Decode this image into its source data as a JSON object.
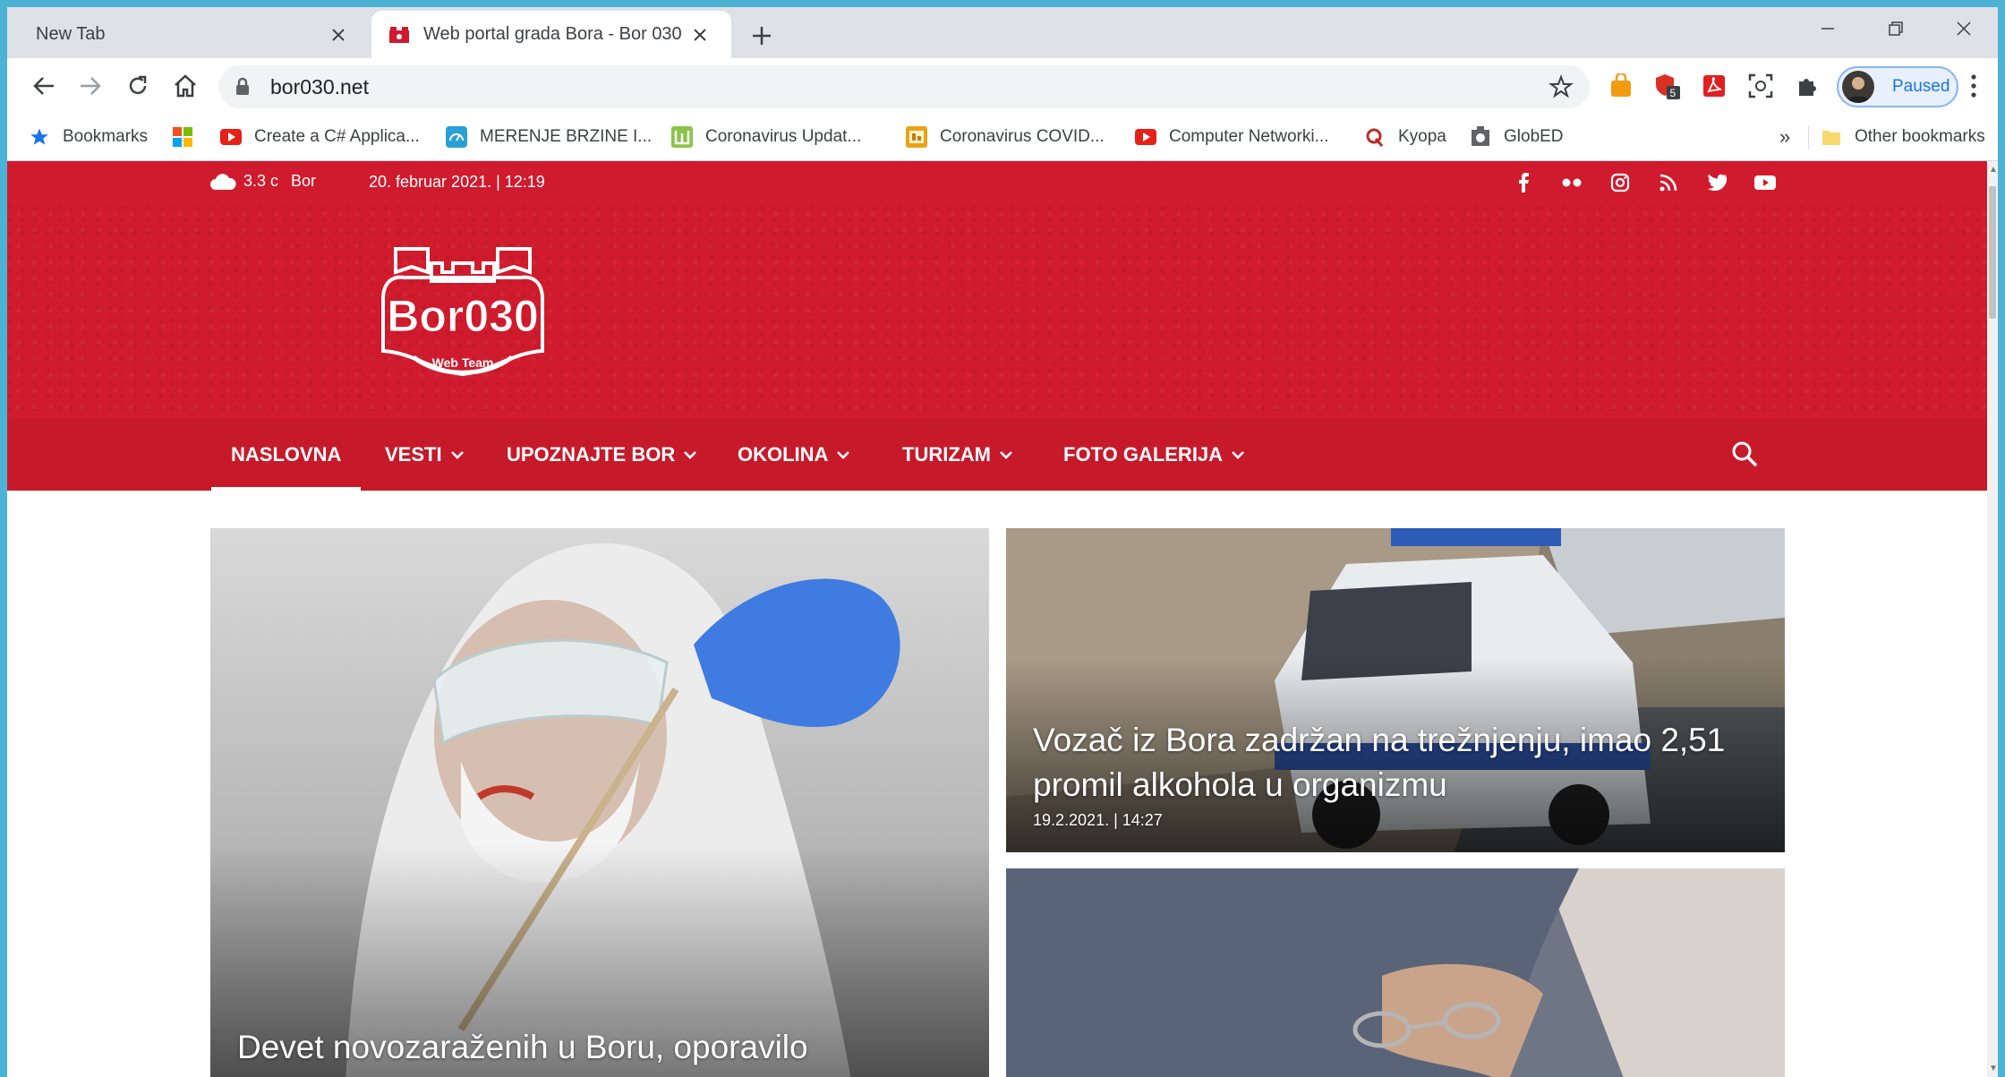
{
  "browser": {
    "tabs": [
      {
        "title": "New Tab",
        "active": false
      },
      {
        "title": "Web portal grada Bora - Bor 030",
        "active": true
      }
    ],
    "url": "bor030.net",
    "profile_label": "Paused",
    "extension_badge": "5",
    "bookmarks": [
      {
        "label": "Bookmarks",
        "icon": "star-icon"
      },
      {
        "label": "",
        "icon": "windows-icon"
      },
      {
        "label": "Create a C# Applica...",
        "icon": "youtube-icon"
      },
      {
        "label": "MERENJE BRZINE I...",
        "icon": "speedtest-icon"
      },
      {
        "label": "Coronavirus Updat...",
        "icon": "worldometer-icon"
      },
      {
        "label": "Coronavirus COVID...",
        "icon": "dashboard-icon"
      },
      {
        "label": "Computer Networki...",
        "icon": "youtube-icon"
      },
      {
        "label": "Kyopa",
        "icon": "quora-icon"
      },
      {
        "label": "GlobED",
        "icon": "globed-icon"
      }
    ],
    "other_bookmarks": "Other bookmarks"
  },
  "site": {
    "weather": {
      "temp": "3.3 c",
      "city": "Bor"
    },
    "date": "20. februar 2021. | 12:19",
    "logo_text": "Bor030",
    "logo_sub": "Web Team",
    "nav": [
      {
        "label": "NASLOVNA",
        "dropdown": false,
        "active": true
      },
      {
        "label": "VESTI",
        "dropdown": true
      },
      {
        "label": "UPOZNAJTE BOR",
        "dropdown": true
      },
      {
        "label": "OKOLINA",
        "dropdown": true
      },
      {
        "label": "TURIZAM",
        "dropdown": true
      },
      {
        "label": "FOTO GALERIJA",
        "dropdown": true
      }
    ],
    "articles": [
      {
        "title": "Devet novozaraženih u Boru, oporavilo",
        "date": ""
      },
      {
        "title": "Vozač iz Bora zadržan na trežnjenju, imao 2,51 promil alkohola u organizmu",
        "date": "19.2.2021. | 14:27"
      },
      {
        "title": "",
        "date": ""
      }
    ],
    "colors": {
      "brand_red": "#cf1b2d"
    }
  }
}
